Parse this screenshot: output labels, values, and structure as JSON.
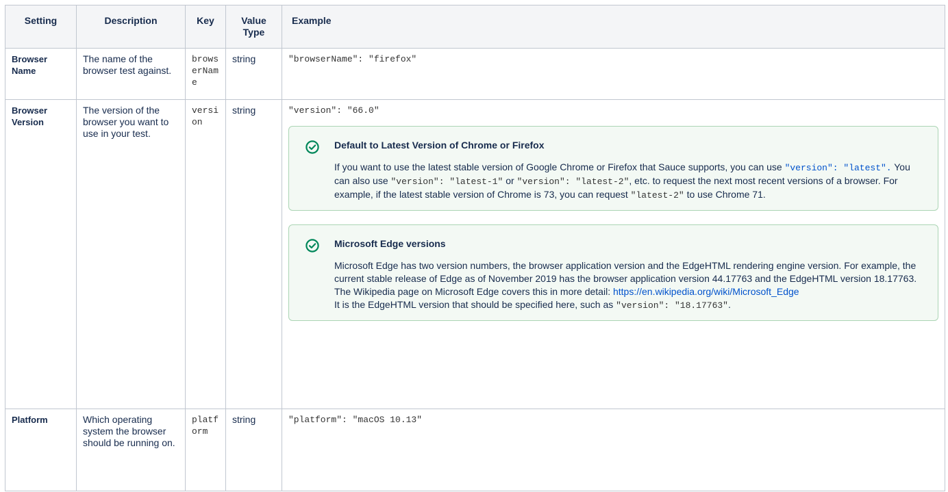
{
  "headers": {
    "setting": "Setting",
    "description": "Description",
    "key": "Key",
    "value_type": "Value Type",
    "example": "Example"
  },
  "rows": [
    {
      "setting": "Browser Name",
      "description": "The name of the browser test against.",
      "key": "browserName",
      "value_type": "string",
      "example": "\"browserName\": \"firefox\""
    },
    {
      "setting": "Browser Version",
      "description": "The version of the browser you want to use in your test.",
      "key": "version",
      "value_type": "string",
      "example": "\"version\": \"66.0\"",
      "panels": [
        {
          "title": "Default to Latest Version of Chrome or Firefox",
          "t1": "If you want to use the latest stable version of Google Chrome or Firefox that Sauce supports, you can use ",
          "c1": "\"version\": \"latest\".",
          "t2": " You can also use ",
          "c2": "\"version\": \"latest-1\"",
          "t3": " or ",
          "c3": "\"version\": \"latest-2\"",
          "t4": ", etc. to request the next most recent versions of a browser. For example, if the latest stable version of Chrome is 73, you can request ",
          "c4": "\"latest-2\"",
          "t5": " to use Chrome 71."
        },
        {
          "title": "Microsoft Edge versions",
          "t1": "Microsoft Edge has two version numbers, the browser application version and the EdgeHTML rendering engine version. For example, the current stable release of Edge as of November 2019 has the browser application version 44.17763 and the EdgeHTML version 18.17763. The Wikipedia page on Microsoft Edge covers this in more detail: ",
          "link": "https://en.wikipedia.org/wiki/Microsoft_Edge",
          "t2": "It is the EdgeHTML version that should be specified here, such as ",
          "c1": "\"version\": \"18.17763\"",
          "t3": "."
        }
      ]
    },
    {
      "setting": "Platform",
      "description": "Which operating system the browser should be running on.",
      "key": "platform",
      "value_type": "string",
      "example": "\"platform\": \"macOS 10.13\""
    }
  ],
  "colors": {
    "header_bg": "#f4f5f7",
    "border": "#c1c7d0",
    "panel_bg": "#f3f9f4",
    "panel_border": "#abd5b4",
    "check_icon": "#00875a",
    "link": "#0052cc"
  },
  "icons": {
    "panel_icon": "check-circle-icon"
  }
}
